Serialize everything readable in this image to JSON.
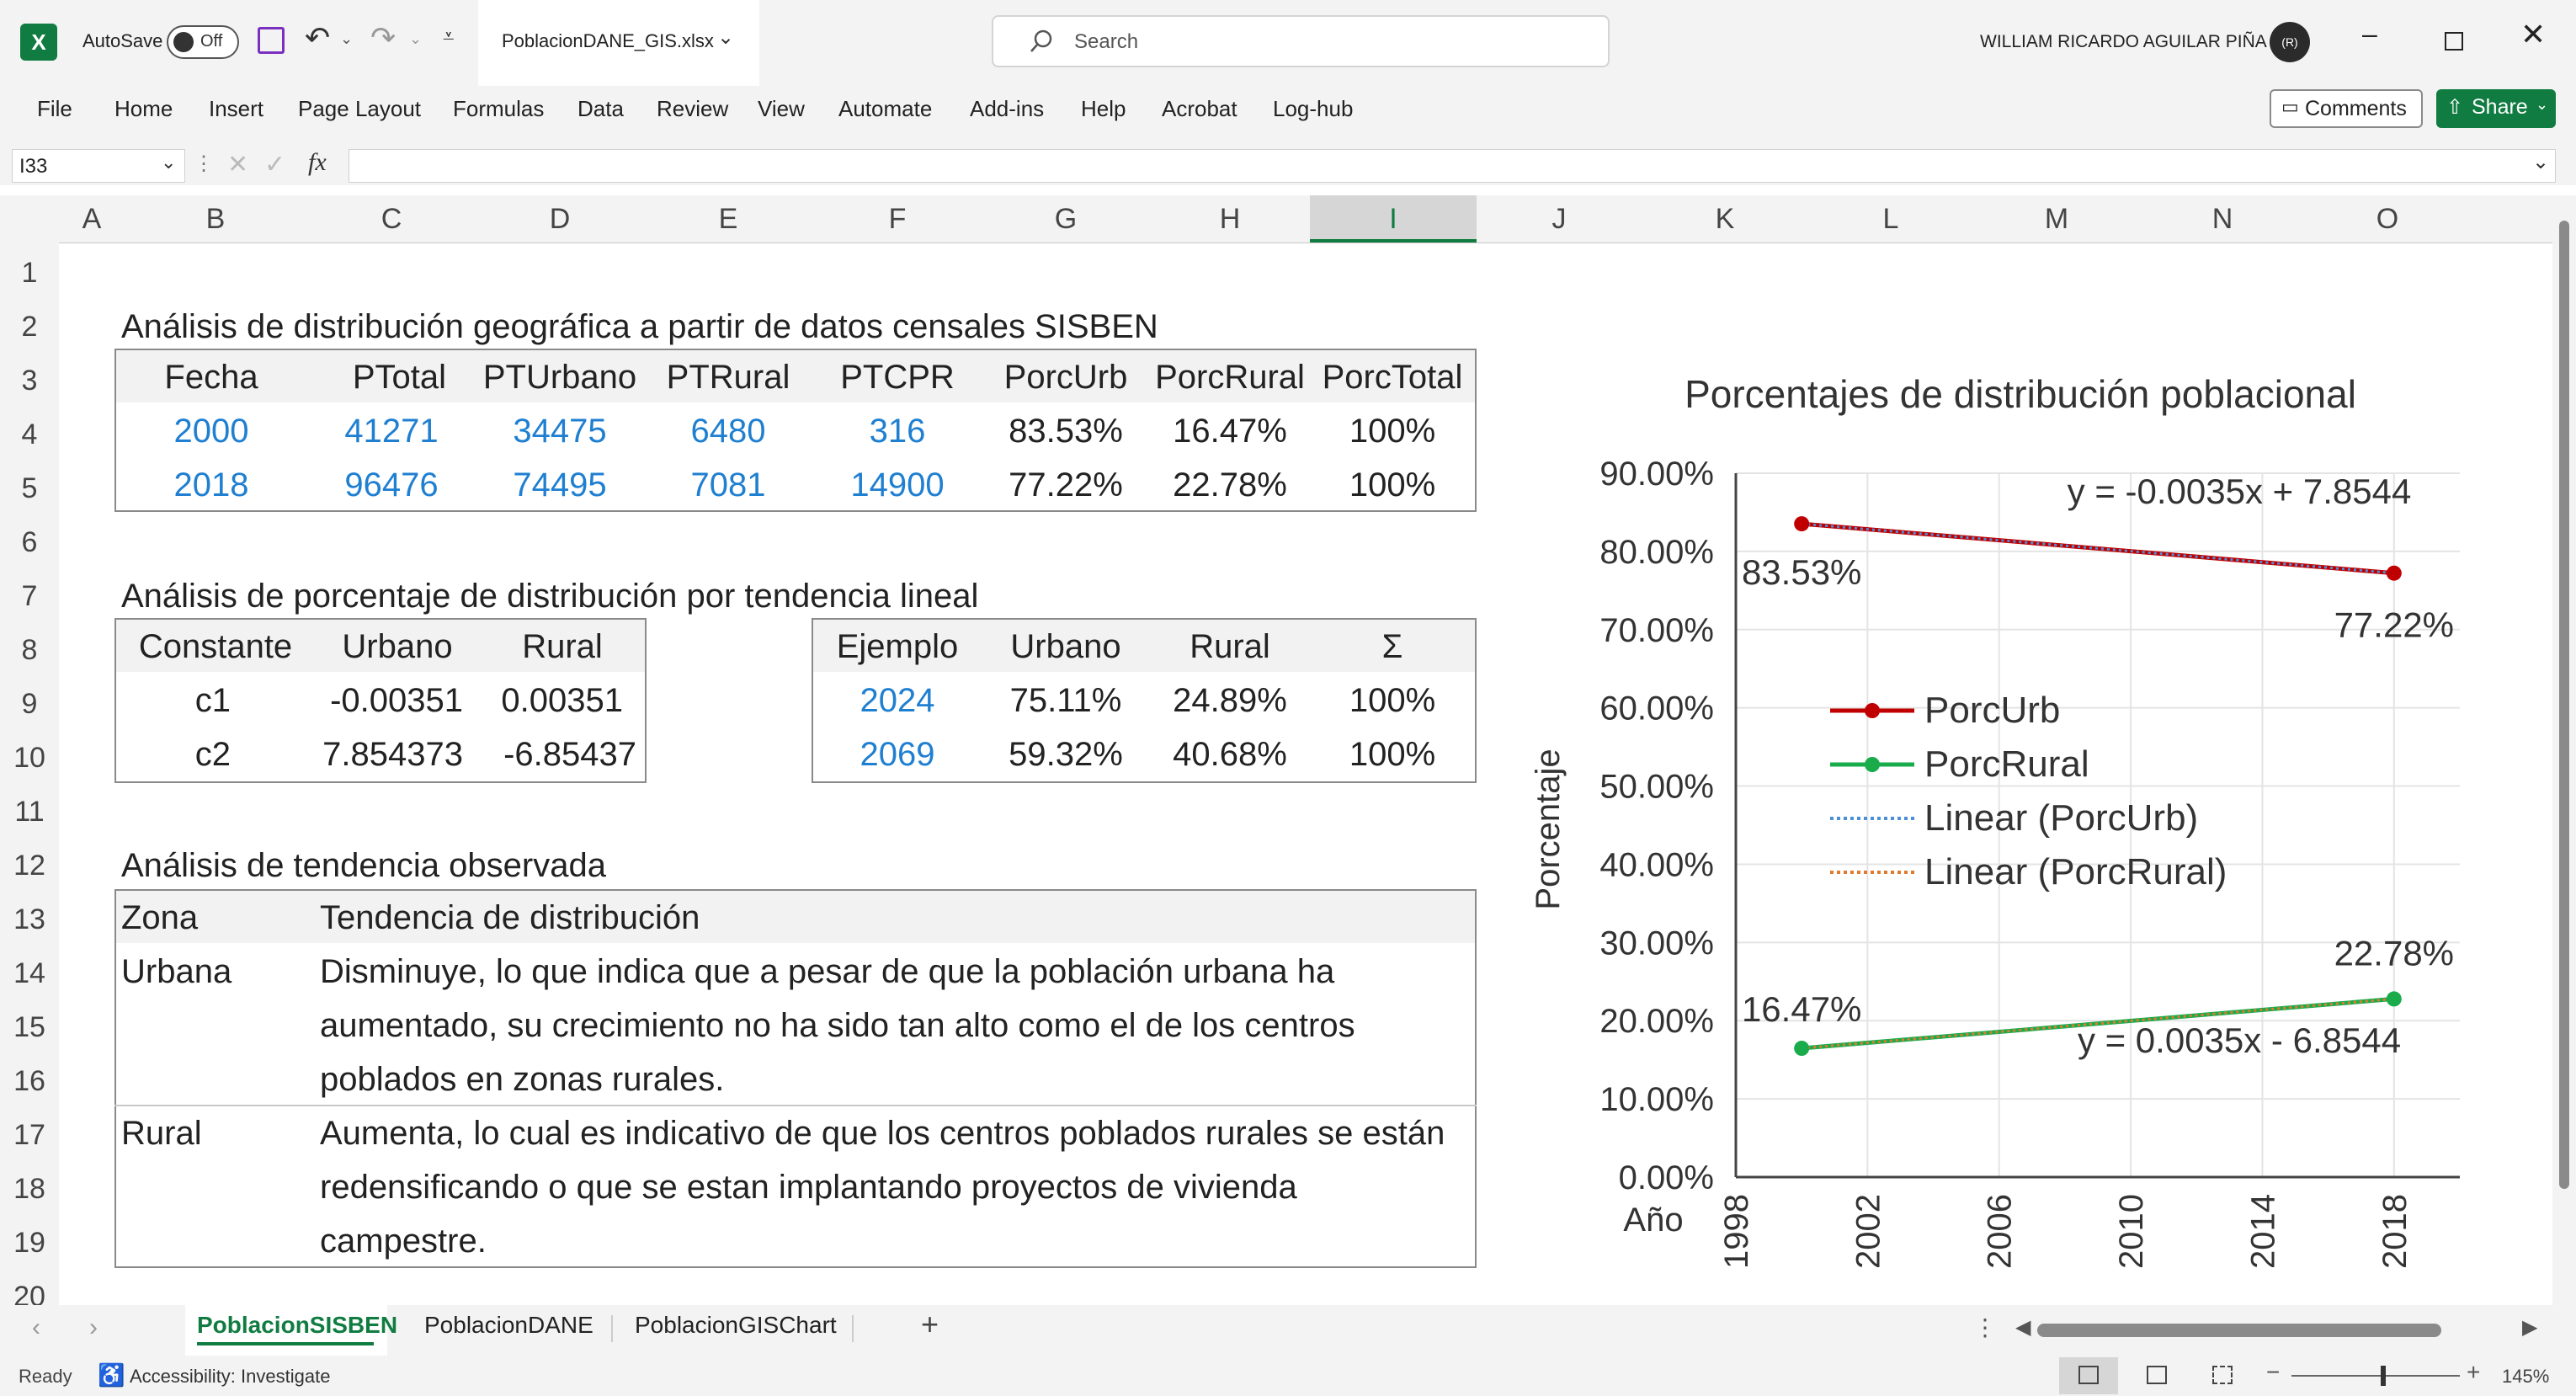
{
  "titlebar": {
    "autosave_label": "AutoSave",
    "autosave_state": "Off",
    "file_name": "PoblacionDANE_GIS.xlsx",
    "search_placeholder": "Search",
    "user_name": "WILLIAM RICARDO AGUILAR PIÑA",
    "avatar_initials": "(R)"
  },
  "ribbon": {
    "tabs": [
      "File",
      "Home",
      "Insert",
      "Page Layout",
      "Formulas",
      "Data",
      "Review",
      "View",
      "Automate",
      "Add-ins",
      "Help",
      "Acrobat",
      "Log-hub"
    ],
    "comments_label": "Comments",
    "share_label": "Share"
  },
  "formula_bar": {
    "name_box": "I33",
    "fx": "fx",
    "formula": ""
  },
  "columns": [
    "A",
    "B",
    "C",
    "D",
    "E",
    "F",
    "G",
    "H",
    "I",
    "J",
    "K",
    "L",
    "M",
    "N",
    "O"
  ],
  "selected_column": "I",
  "rows": [
    "1",
    "2",
    "3",
    "4",
    "5",
    "6",
    "7",
    "8",
    "9",
    "10",
    "11",
    "12",
    "13",
    "14",
    "15",
    "16",
    "17",
    "18",
    "19",
    "20"
  ],
  "section1": {
    "title": "Análisis de distribución geográfica a partir de datos censales SISBEN",
    "headers": [
      "Fecha",
      "PTotal",
      "PTUrbano",
      "PTRural",
      "PTCPR",
      "PorcUrb",
      "PorcRural",
      "PorcTotal"
    ],
    "rows": [
      [
        "2000",
        "41271",
        "34475",
        "6480",
        "316",
        "83.53%",
        "16.47%",
        "100%"
      ],
      [
        "2018",
        "96476",
        "74495",
        "7081",
        "14900",
        "77.22%",
        "22.78%",
        "100%"
      ]
    ]
  },
  "section2": {
    "title": "Análisis de porcentaje de distribución por tendencia lineal",
    "constants": {
      "headers": [
        "Constante",
        "Urbano",
        "Rural"
      ],
      "rows": [
        [
          "c1",
          "-0.00351",
          "0.00351"
        ],
        [
          "c2",
          "7.854373",
          "-6.85437"
        ]
      ]
    },
    "examples": {
      "headers": [
        "Ejemplo",
        "Urbano",
        "Rural",
        "Σ"
      ],
      "rows": [
        [
          "2024",
          "75.11%",
          "24.89%",
          "100%"
        ],
        [
          "2069",
          "59.32%",
          "40.68%",
          "100%"
        ]
      ]
    }
  },
  "section3": {
    "title": "Análisis de tendencia observada",
    "headers": [
      "Zona",
      "Tendencia de distribución"
    ],
    "rows": [
      {
        "zona": "Urbana",
        "lines": [
          "Disminuye, lo que indica que a pesar de que la población urbana ha",
          "aumentado, su crecimiento no ha sido tan alto como el de los centros",
          "poblados en zonas rurales."
        ]
      },
      {
        "zona": "Rural",
        "lines": [
          "Aumenta, lo cual es indicativo de que los centros poblados rurales se están",
          "redensificando o que se estan implantando proyectos de vivienda",
          "campestre."
        ]
      }
    ]
  },
  "chart_data": {
    "type": "line",
    "title": "Porcentajes de distribución poblacional",
    "xlabel": "Año",
    "ylabel": "Porcentaje",
    "xlim": [
      1998,
      2020
    ],
    "x_ticks": [
      "1998",
      "2002",
      "2006",
      "2010",
      "2014",
      "2018"
    ],
    "ylim": [
      0,
      0.9
    ],
    "y_ticks": [
      "0.00%",
      "10.00%",
      "20.00%",
      "30.00%",
      "40.00%",
      "50.00%",
      "60.00%",
      "70.00%",
      "80.00%",
      "90.00%"
    ],
    "grid": true,
    "legend_position": "center-left",
    "series": [
      {
        "name": "PorcUrb",
        "x": [
          2000,
          2018
        ],
        "values": [
          0.8353,
          0.7722
        ],
        "labels": [
          "83.53%",
          "77.22%"
        ],
        "color": "#c00000"
      },
      {
        "name": "PorcRural",
        "x": [
          2000,
          2018
        ],
        "values": [
          0.1647,
          0.2278
        ],
        "labels": [
          "16.47%",
          "22.78%"
        ],
        "color": "#1aab4b"
      }
    ],
    "trendlines": [
      {
        "name": "Linear (PorcUrb)",
        "equation": "y = -0.0035x + 7.8544",
        "color": "#4a90d9"
      },
      {
        "name": "Linear (PorcRural)",
        "equation": "y = 0.0035x - 6.8544",
        "color": "#e07a2e"
      }
    ]
  },
  "sheets": {
    "tabs": [
      "PoblacionSISBEN",
      "PoblacionDANE",
      "PoblacionGISChart"
    ],
    "active": "PoblacionSISBEN",
    "add_label": "+"
  },
  "status": {
    "ready": "Ready",
    "accessibility": "Accessibility: Investigate",
    "zoom": "145%"
  },
  "colors": {
    "excel_green": "#107c41",
    "link_blue": "#1f7fd1"
  }
}
